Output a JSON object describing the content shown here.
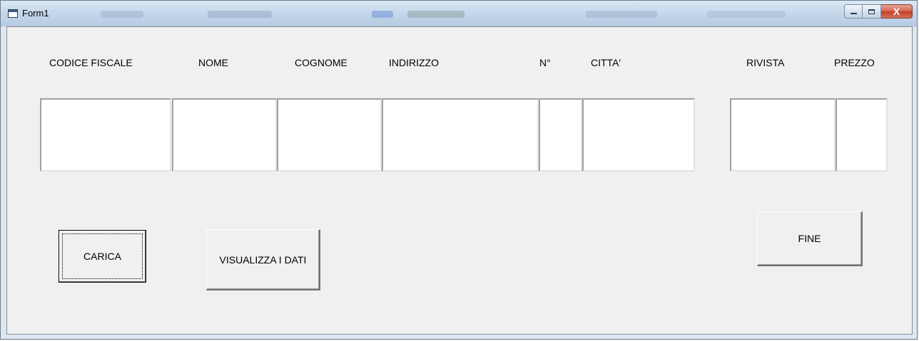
{
  "window": {
    "title": "Form1",
    "controls": {
      "minimize": "minimize",
      "maximize": "maximize",
      "close": "X"
    }
  },
  "labels": {
    "codice_fiscale": "CODICE FISCALE",
    "nome": "NOME",
    "cognome": "COGNOME",
    "indirizzo": "INDIRIZZO",
    "numero": "N°",
    "citta": "CITTA'",
    "rivista": "RIVISTA",
    "prezzo": "PREZZO"
  },
  "fields": {
    "codice_fiscale": "",
    "nome": "",
    "cognome": "",
    "indirizzo": "",
    "numero": "",
    "citta": "",
    "rivista": "",
    "prezzo": ""
  },
  "buttons": {
    "carica": "CARICA",
    "visualizza": "VISUALIZZA I DATI",
    "fine": "FINE"
  }
}
